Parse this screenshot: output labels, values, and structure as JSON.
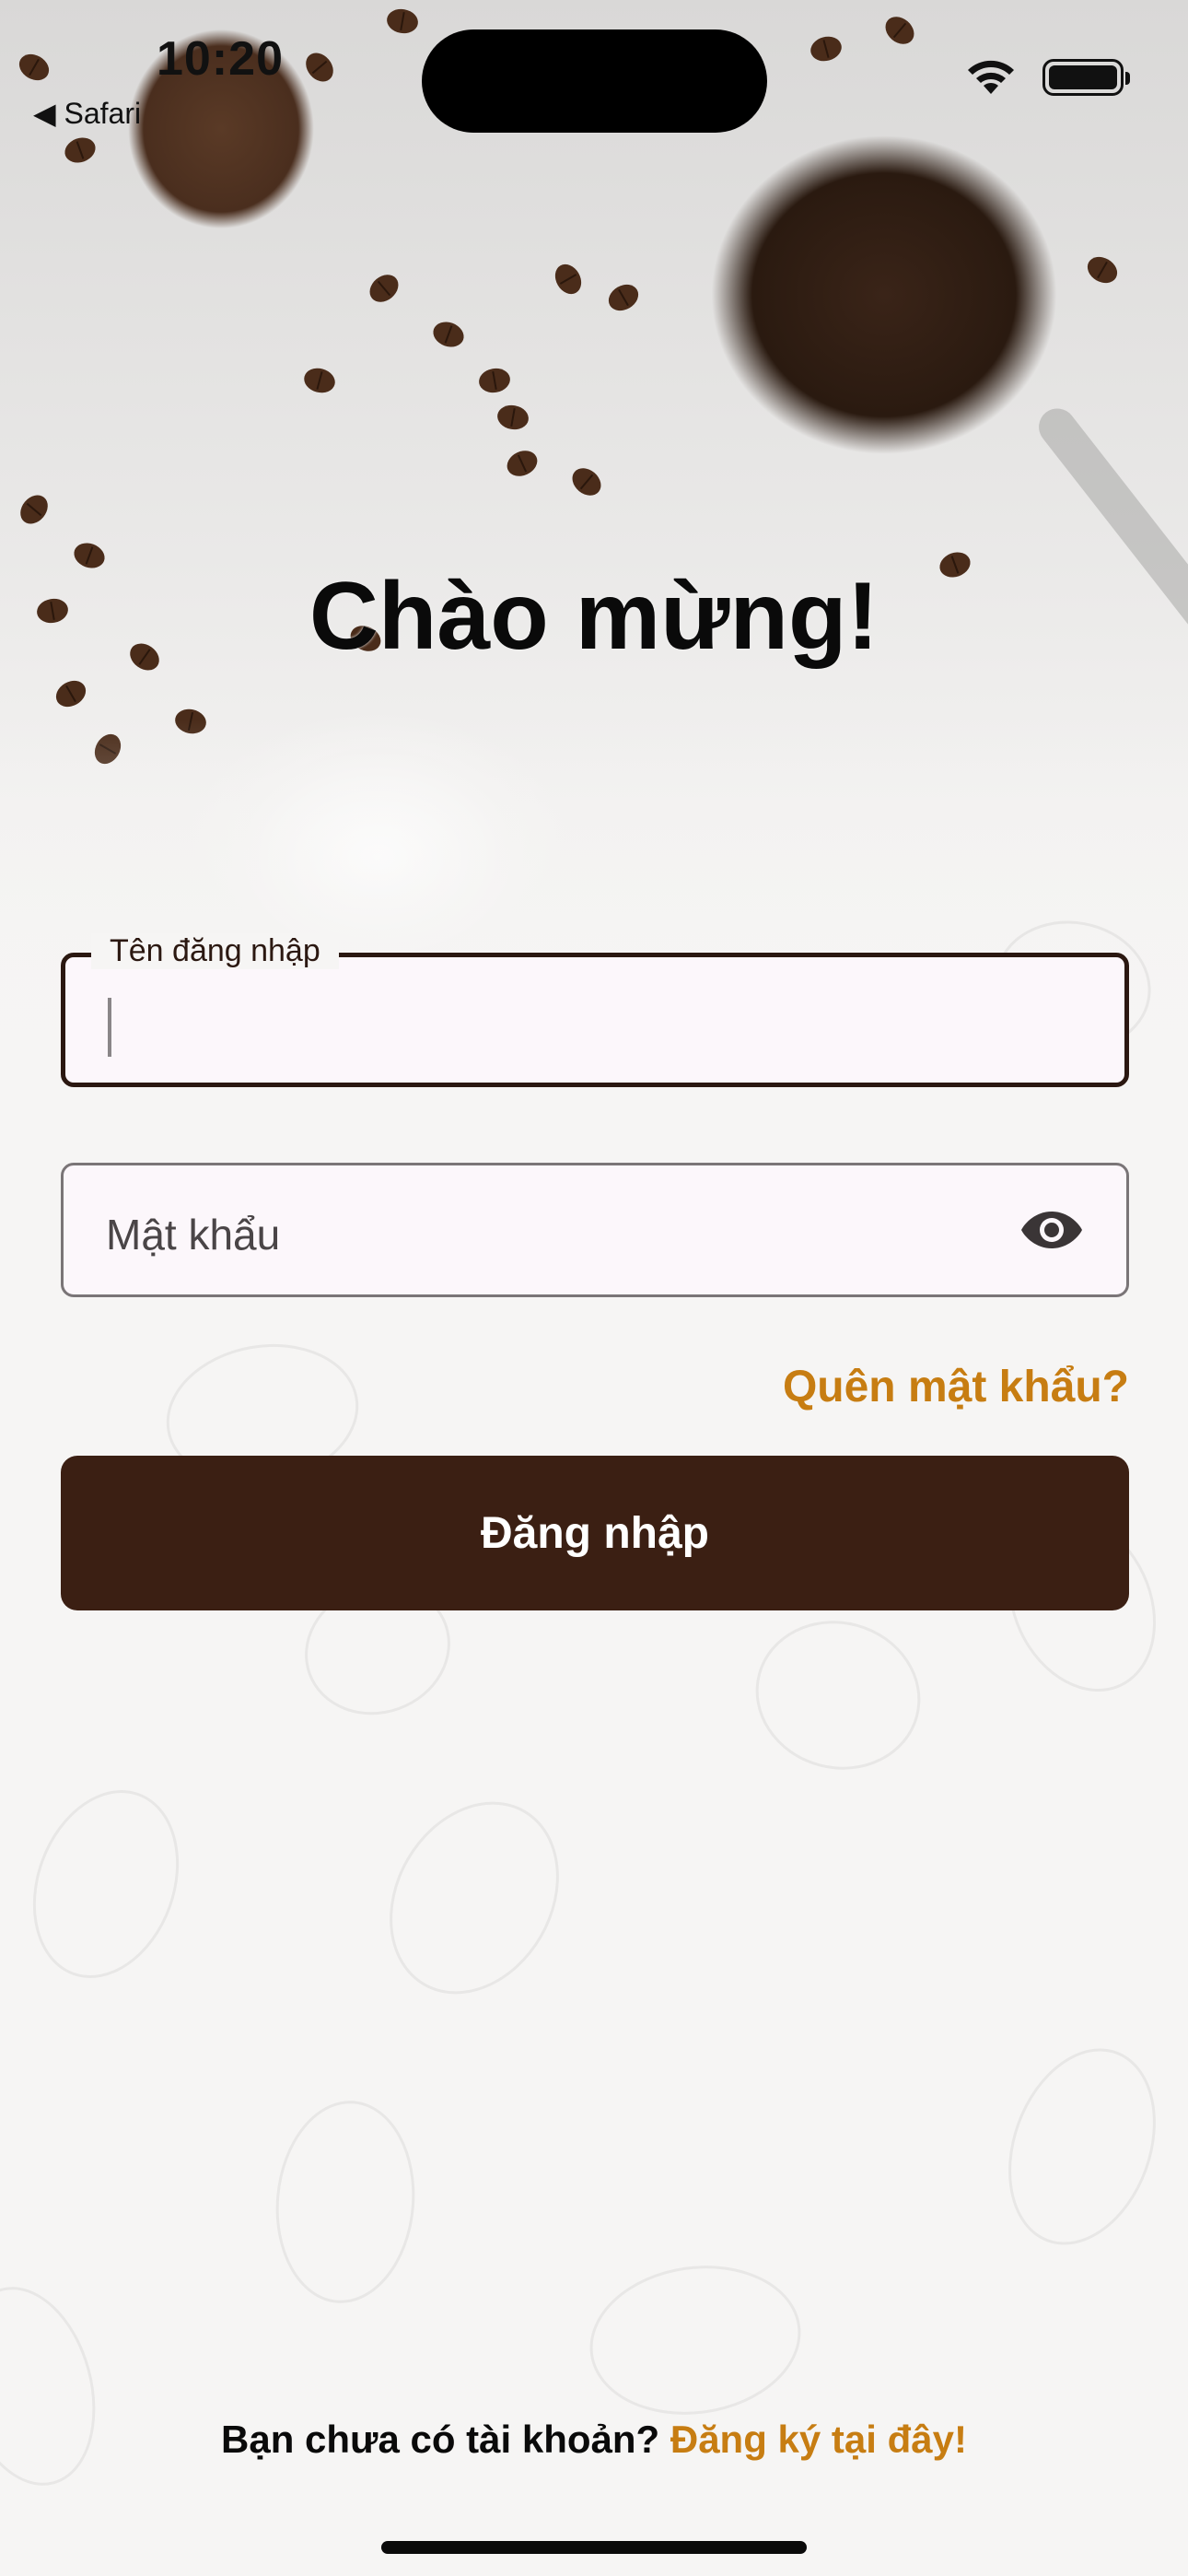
{
  "status_bar": {
    "time": "10:20",
    "back_app": "◀ Safari"
  },
  "main": {
    "title": "Chào mừng!",
    "username_field": {
      "label": "Tên đăng nhập",
      "value": ""
    },
    "password_field": {
      "placeholder": "Mật khẩu",
      "toggle_icon": "eye-icon"
    },
    "forgot_password": "Quên mật khẩu?",
    "login_button": "Đăng nhập"
  },
  "footer": {
    "prompt": "Bạn chưa có tài khoản?",
    "signup_link": "Đăng ký tại đây!"
  },
  "colors": {
    "accent": "#c77d12",
    "primary_button": "#3b1f13",
    "focused_border": "#2b1811"
  }
}
